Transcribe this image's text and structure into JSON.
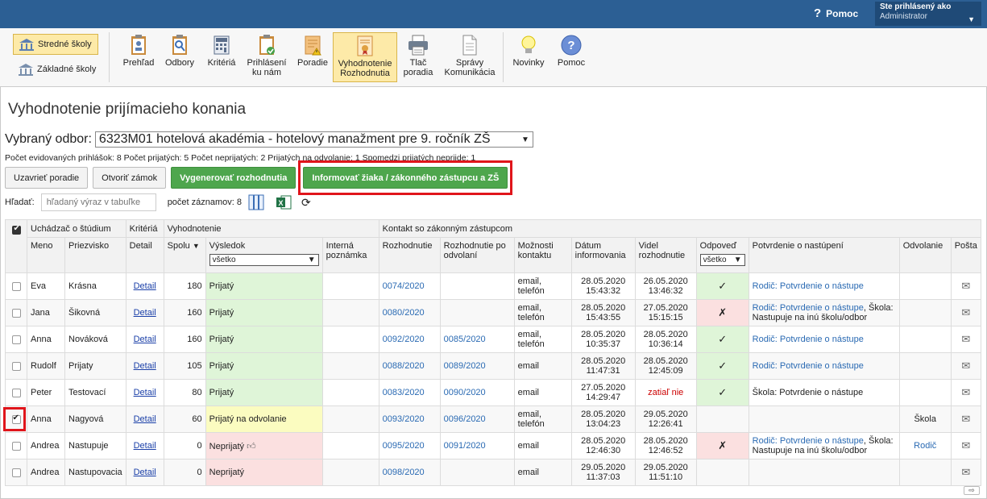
{
  "header": {
    "help_label": "Pomoc",
    "user_title": "Ste prihlásený ako",
    "user_name": "Administrator"
  },
  "toolbar": {
    "school_buttons": [
      {
        "label": "Stredné školy",
        "active": true
      },
      {
        "label": "Základné školy",
        "active": false
      }
    ],
    "items": [
      {
        "label": "Prehľad",
        "icon": "clipboard-overview-icon"
      },
      {
        "label": "Odbory",
        "icon": "clipboard-search-icon"
      },
      {
        "label": "Kritériá",
        "icon": "calculator-icon"
      },
      {
        "label": "Prihlásení\nku nám",
        "icon": "clipboard-check-icon"
      },
      {
        "label": "Poradie",
        "icon": "ranking-warning-icon"
      },
      {
        "label": "Vyhodnotenie\nRozhodnutia",
        "icon": "certificate-icon",
        "active": true
      },
      {
        "label": "Tlač\nporadia",
        "icon": "printer-icon"
      },
      {
        "label": "Správy\nKomunikácia",
        "icon": "document-icon"
      },
      {
        "label": "Novinky",
        "icon": "lightbulb-icon"
      },
      {
        "label": "Pomoc",
        "icon": "help-circle-icon"
      }
    ]
  },
  "page": {
    "title": "Vyhodnotenie prijímacieho konania",
    "odbor_label": "Vybraný odbor:",
    "odbor_value": "6323M01 hotelová akadémia - hotelový manažment pre 9. ročník ZŠ",
    "stats": "Počet evidovaných prihlášok: 8 Počet prijatých: 5 Počet neprijatých: 2 Prijatých na odvolanie: 1 Spomedzi prijatých neprijde: 1"
  },
  "actions": {
    "close_order": "Uzavrieť poradie",
    "open_lock": "Otvoriť zámok",
    "generate": "Vygenerovať rozhodnutia",
    "inform": "Informovať žiaka / zákonného zástupcu a ZŠ"
  },
  "search": {
    "label": "Hľadať:",
    "placeholder": "hľadaný výraz v tabuľke",
    "count_label": "počet záznamov: 8"
  },
  "table": {
    "group_headers": {
      "applicant": "Uchádzač o štúdium",
      "criteria": "Kritériá",
      "evaluation": "Vyhodnotenie",
      "contact": "Kontakt so zákonným zástupcom"
    },
    "columns": {
      "meno": "Meno",
      "priezvisko": "Priezvisko",
      "detail": "Detail",
      "spolu": "Spolu",
      "vysledok": "Výsledok",
      "interna": "Interná poznámka",
      "rozhodnutie": "Rozhodnutie",
      "rozhodnutie_odvolanie": "Rozhodnutie po odvolaní",
      "moznosti": "Možnosti kontaktu",
      "datum": "Dátum informovania",
      "videl": "Videl rozhodnutie",
      "odpoved": "Odpoveď",
      "potvrdenie": "Potvrdenie o nastúpení",
      "odvolanie": "Odvolanie",
      "posta": "Pošta"
    },
    "filter_vysledok": "všetko",
    "filter_odpoved": "všetko",
    "rows": [
      {
        "checked": false,
        "meno": "Eva",
        "priezvisko": "Krásna",
        "detail": "Detail",
        "spolu": "180",
        "vysledok": "Prijatý",
        "status": "g",
        "rozhodnutie": "0074/2020",
        "rozh_odvol": "",
        "kontakt": "email,\ntelefón",
        "datum": "28.05.2020\n15:43:32",
        "videl": "26.05.2020\n13:46:32",
        "odpoved": "✓",
        "odp_status": "g",
        "potvrdenie_link": "Rodič: Potvrdenie o nástupe",
        "potvrdenie_text": "",
        "odvolanie": "",
        "odvolanie_link": false
      },
      {
        "checked": false,
        "meno": "Jana",
        "priezvisko": "Šikovná",
        "detail": "Detail",
        "spolu": "160",
        "vysledok": "Prijatý",
        "status": "g",
        "rozhodnutie": "0080/2020",
        "rozh_odvol": "",
        "kontakt": "email,\ntelefón",
        "datum": "28.05.2020\n15:43:55",
        "videl": "27.05.2020\n15:15:15",
        "odpoved": "✗",
        "odp_status": "r",
        "potvrdenie_link": "Rodič: Potvrdenie o nástupe",
        "potvrdenie_text": ", Škola: Nastupuje na inú školu/odbor",
        "odvolanie": "",
        "odvolanie_link": false
      },
      {
        "checked": false,
        "meno": "Anna",
        "priezvisko": "Nováková",
        "detail": "Detail",
        "spolu": "160",
        "vysledok": "Prijatý",
        "status": "g",
        "rozhodnutie": "0092/2020",
        "rozh_odvol": "0085/2020",
        "kontakt": "email,\ntelefón",
        "datum": "28.05.2020\n10:35:37",
        "videl": "28.05.2020\n10:36:14",
        "odpoved": "✓",
        "odp_status": "g",
        "potvrdenie_link": "Rodič: Potvrdenie o nástupe",
        "potvrdenie_text": "",
        "odvolanie": "",
        "odvolanie_link": false
      },
      {
        "checked": false,
        "meno": "Rudolf",
        "priezvisko": "Prijaty",
        "detail": "Detail",
        "spolu": "105",
        "vysledok": "Prijatý",
        "status": "g",
        "rozhodnutie": "0088/2020",
        "rozh_odvol": "0089/2020",
        "kontakt": "email",
        "datum": "28.05.2020\n11:47:31",
        "videl": "28.05.2020\n12:45:09",
        "odpoved": "✓",
        "odp_status": "g",
        "potvrdenie_link": "Rodič: Potvrdenie o nástupe",
        "potvrdenie_text": "",
        "odvolanie": "",
        "odvolanie_link": false
      },
      {
        "checked": false,
        "meno": "Peter",
        "priezvisko": "Testovací",
        "detail": "Detail",
        "spolu": "80",
        "vysledok": "Prijatý",
        "status": "g",
        "rozhodnutie": "0083/2020",
        "rozh_odvol": "0090/2020",
        "kontakt": "email",
        "datum": "27.05.2020\n14:29:47",
        "videl": "zatiaľ nie",
        "videl_red": true,
        "odpoved": "✓",
        "odp_status": "g",
        "potvrdenie_link": "",
        "potvrdenie_text": "Škola: Potvrdenie o nástupe",
        "odvolanie": "",
        "odvolanie_link": false
      },
      {
        "checked": true,
        "meno": "Anna",
        "priezvisko": "Nagyová",
        "detail": "Detail",
        "spolu": "60",
        "vysledok": "Prijatý na odvolanie",
        "status": "y",
        "rozhodnutie": "0093/2020",
        "rozh_odvol": "0096/2020",
        "kontakt": "email,\ntelefón",
        "datum": "28.05.2020\n13:04:23",
        "videl": "29.05.2020\n12:26:41",
        "odpoved": "",
        "odp_status": "",
        "potvrdenie_link": "",
        "potvrdenie_text": "",
        "odvolanie": "Škola",
        "odvolanie_link": false
      },
      {
        "checked": false,
        "meno": "Andrea",
        "priezvisko": "Nastupuje",
        "detail": "Detail",
        "spolu": "0",
        "vysledok": "Neprijatý",
        "thumb": true,
        "status": "r",
        "rozhodnutie": "0095/2020",
        "rozh_odvol": "0091/2020",
        "kontakt": "email",
        "datum": "28.05.2020\n12:46:30",
        "videl": "28.05.2020\n12:46:52",
        "odpoved": "✗",
        "odp_status": "r",
        "potvrdenie_link": "Rodič: Potvrdenie o nástupe",
        "potvrdenie_text": ", Škola: Nastupuje na inú školu/odbor",
        "odvolanie": "Rodič",
        "odvolanie_link": true
      },
      {
        "checked": false,
        "meno": "Andrea",
        "priezvisko": "Nastupovacia",
        "detail": "Detail",
        "spolu": "0",
        "vysledok": "Neprijatý",
        "status": "r",
        "rozhodnutie": "0098/2020",
        "rozh_odvol": "",
        "kontakt": "email",
        "datum": "29.05.2020\n11:37:03",
        "videl": "29.05.2020\n11:51:10",
        "odpoved": "",
        "odp_status": "",
        "potvrdenie_link": "",
        "potvrdenie_text": "",
        "odvolanie": "",
        "odvolanie_link": false
      }
    ]
  },
  "colors": {
    "header_bg": "#2c5f94",
    "accept_green": "#dff5d8",
    "appeal_yellow": "#fbfcc0",
    "reject_red": "#fbe0e0",
    "highlight_red": "#e0151b"
  }
}
